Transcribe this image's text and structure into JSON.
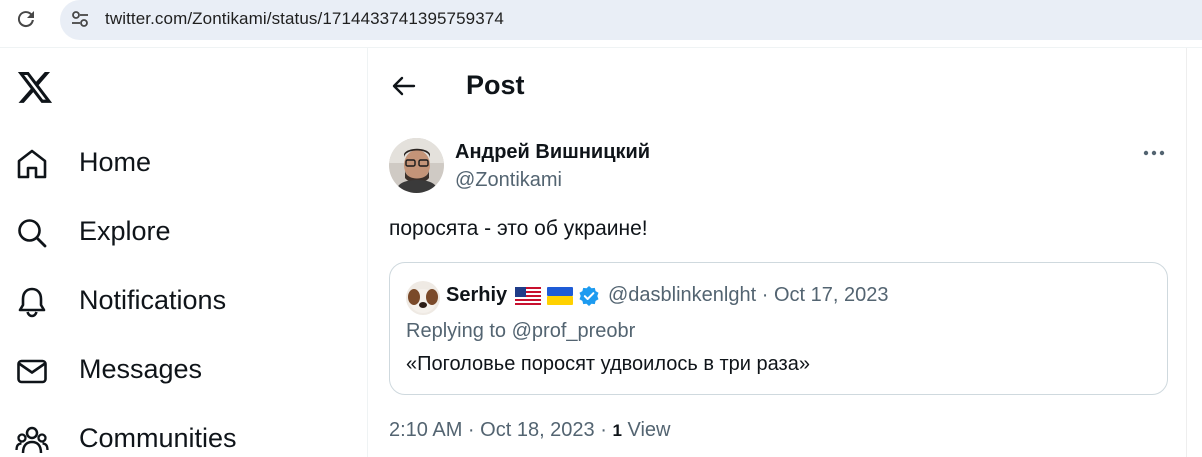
{
  "browser": {
    "url": "twitter.com/Zontikami/status/1714433741395759374"
  },
  "nav": {
    "logo": "x-logo",
    "items": [
      {
        "label": "Home",
        "icon": "home-icon"
      },
      {
        "label": "Explore",
        "icon": "search-icon"
      },
      {
        "label": "Notifications",
        "icon": "bell-icon"
      },
      {
        "label": "Messages",
        "icon": "envelope-icon"
      },
      {
        "label": "Communities",
        "icon": "communities-icon"
      }
    ]
  },
  "header": {
    "title": "Post"
  },
  "tweet": {
    "author_name": "Андрей Вишницкий",
    "author_handle": "@Zontikami",
    "text": "поросята - это об украине!",
    "time": "2:10 AM · Oct 18, 2023 · ",
    "views_count": "1",
    "views_label": " View"
  },
  "quote": {
    "author_name": "Serhiy",
    "meta": "@dasblinkenlght · Oct 17, 2023",
    "replying_prefix": "Replying to ",
    "replying_to": "@prof_preobr",
    "text": "«Поголовье поросят удвоилось в три раза»"
  },
  "colors": {
    "text_primary": "#0f1419",
    "text_secondary": "#536471",
    "verified": "#1d9bf0",
    "url_bar": "#e9eef6",
    "border": "#cfd9de"
  }
}
